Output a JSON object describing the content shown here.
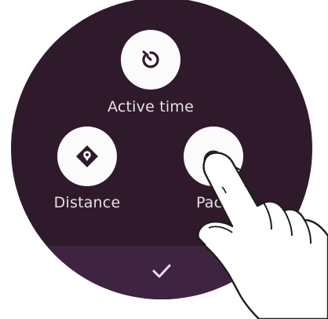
{
  "options": [
    {
      "label": "Active time",
      "icon": "timer-icon"
    },
    {
      "label": "Distance",
      "icon": "location-diamond-icon"
    },
    {
      "label": "Pac",
      "icon": "speedometer-icon"
    }
  ],
  "confirm": {
    "icon": "checkmark-icon"
  },
  "colors": {
    "face": "#2f1a2c",
    "confirm_bar": "#3e2441",
    "option_bg": "#fbfbfb",
    "icon": "#2f1a2c",
    "label": "#e6e1e6"
  }
}
